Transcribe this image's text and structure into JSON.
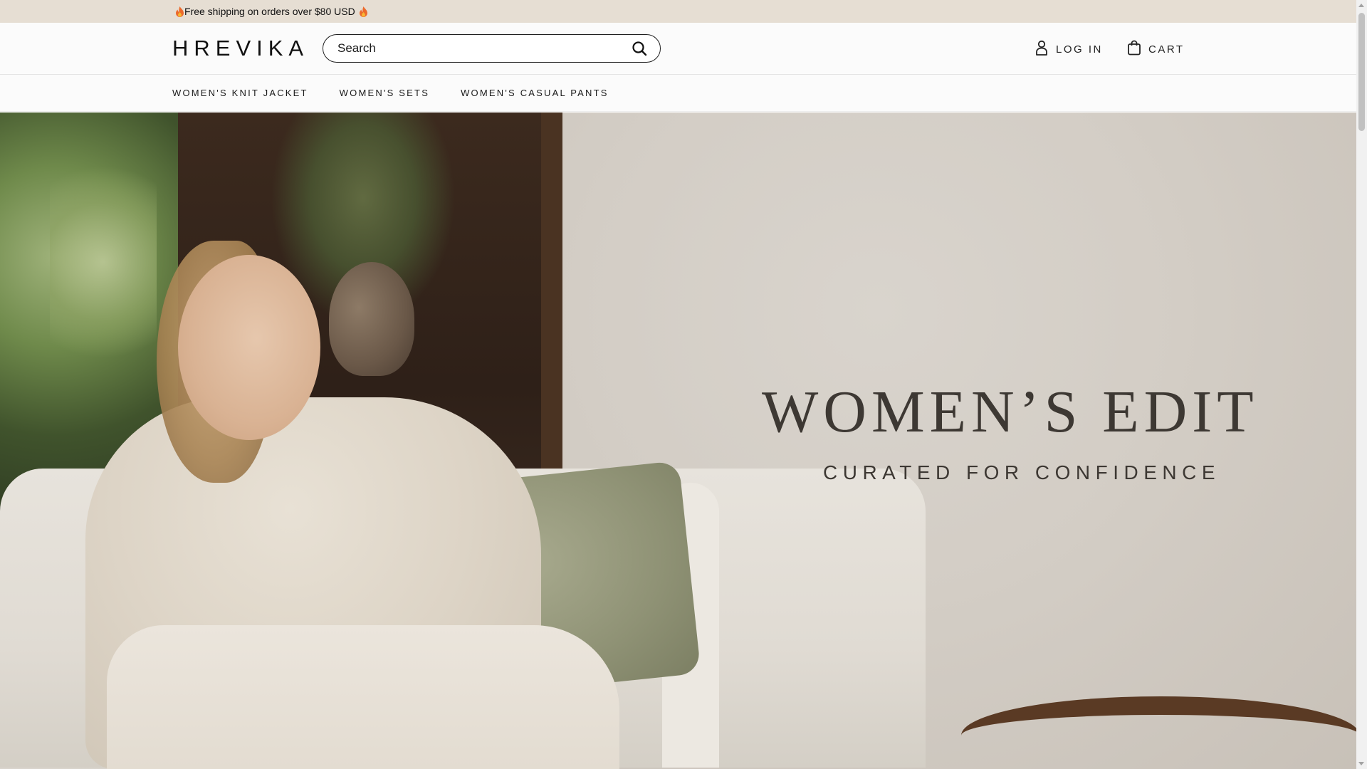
{
  "announcement": {
    "text": "Free shipping on orders over $80 USD"
  },
  "header": {
    "logo": "HREVIKA",
    "search_placeholder": "Search",
    "login_label": "LOG IN",
    "cart_label": "CART"
  },
  "nav": {
    "items": [
      {
        "label": "WOMEN'S KNIT JACKET"
      },
      {
        "label": "WOMEN'S SETS"
      },
      {
        "label": "WOMEN'S CASUAL PANTS"
      }
    ]
  },
  "hero": {
    "title": "WOMEN’S EDIT",
    "subtitle": "CURATED FOR CONFIDENCE"
  },
  "colors": {
    "announcement_bg": "#e6ded3",
    "header_bg": "#fbfbfb",
    "hero_text": "#3d3833",
    "flame": "#e8572a"
  },
  "icons": [
    "flame-icon",
    "search-icon",
    "user-icon",
    "shopping-bag-icon"
  ]
}
